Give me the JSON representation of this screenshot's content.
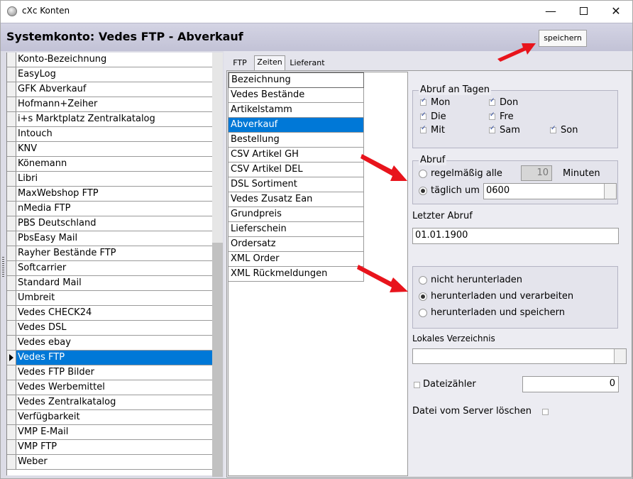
{
  "window": {
    "title": "cXc Konten"
  },
  "header": {
    "title": "Systemkonto: Vedes FTP - Abverkauf",
    "save_label": "speichern"
  },
  "accounts": {
    "header": "Konto-Bezeichnung",
    "items": [
      "EasyLog",
      "GFK Abverkauf",
      "Hofmann+Zeiher",
      "i+s Marktplatz Zentralkatalog",
      "Intouch",
      "KNV",
      "Könemann",
      "Libri",
      "MaxWebshop FTP",
      "nMedia FTP",
      "PBS Deutschland",
      "PbsEasy Mail",
      "Rayher Bestände FTP",
      "Softcarrier",
      "Standard Mail",
      "Umbreit",
      "Vedes CHECK24",
      "Vedes DSL",
      "Vedes ebay",
      "Vedes FTP",
      "Vedes FTP Bilder",
      "Vedes Werbemittel",
      "Vedes Zentralkatalog",
      "Verfügbarkeit",
      "VMP E-Mail",
      "VMP FTP",
      "Weber"
    ],
    "selected": "Vedes FTP"
  },
  "tabs": {
    "items": [
      "FTP",
      "Zeiten",
      "Lieferant"
    ],
    "active": "Zeiten"
  },
  "jobs": {
    "header": "Bezeichnung",
    "items": [
      "Vedes Bestände",
      "Artikelstamm",
      "Abverkauf",
      "Bestellung",
      "CSV Artikel GH",
      "CSV Artikel DEL",
      "DSL Sortiment",
      "Vedes Zusatz Ean",
      "Grundpreis",
      "Lieferschein",
      "Ordersatz",
      "XML Order",
      "XML Rückmeldungen"
    ],
    "selected": "Abverkauf"
  },
  "days": {
    "label": "Abruf an Tagen",
    "items": [
      {
        "label": "Mon",
        "checked": true
      },
      {
        "label": "Don",
        "checked": true
      },
      {
        "label": "Die",
        "checked": true
      },
      {
        "label": "Fre",
        "checked": true
      },
      {
        "label": "Mit",
        "checked": true
      },
      {
        "label": "Sam",
        "checked": true
      },
      {
        "label": "Son",
        "checked": true
      }
    ]
  },
  "abruf": {
    "label": "Abruf",
    "regular_label": "regelmäßig alle",
    "interval_value": "10",
    "minutes_label": "Minuten",
    "daily_label": "täglich um",
    "time_value": "0600",
    "selected": "daily"
  },
  "last": {
    "label": "Letzter Abruf",
    "value": "01.01.1900"
  },
  "mode": {
    "options": [
      "nicht herunterladen",
      "herunterladen und verarbeiten",
      "herunterladen und speichern"
    ],
    "selected": "herunterladen und verarbeiten"
  },
  "local_dir": {
    "label": "Lokales Verzeichnis",
    "value": ""
  },
  "counter": {
    "label": "Dateizähler",
    "checked": false,
    "value": "0"
  },
  "delete": {
    "label": "Datei vom Server löschen",
    "checked": false
  },
  "colors": {
    "selection": "#0078d7",
    "arrow": "#e8141c",
    "header_band": "#c8c8da"
  }
}
